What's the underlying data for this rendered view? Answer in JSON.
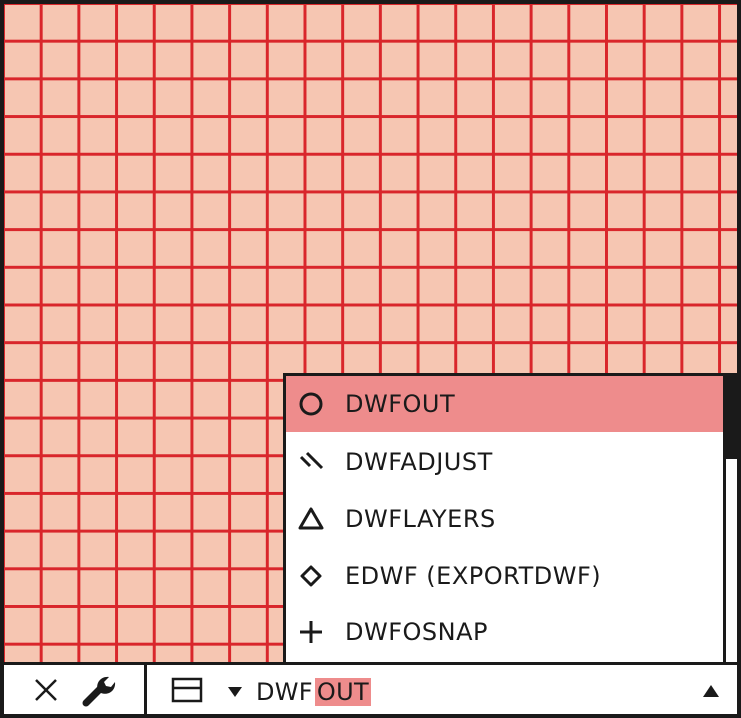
{
  "autocomplete": {
    "items": [
      {
        "label": "DWFOUT",
        "icon": "circle-icon",
        "selected": true
      },
      {
        "label": "DWFADJUST",
        "icon": "diagonal-lines-icon",
        "selected": false
      },
      {
        "label": "DWFLAYERS",
        "icon": "triangle-icon",
        "selected": false
      },
      {
        "label": "EDWF (EXPORTDWF)",
        "icon": "diamond-icon",
        "selected": false
      },
      {
        "label": "DWFOSNAP",
        "icon": "plus-icon",
        "selected": false
      }
    ]
  },
  "command_line": {
    "typed": "DWF",
    "completion": "OUT",
    "close_icon": "close-icon",
    "customize_icon": "wrench-icon",
    "recent_icon": "recent-commands-icon",
    "dropdown_icon": "triangle-down-icon",
    "history_icon": "triangle-up-icon"
  },
  "colors": {
    "grid_line": "#d9262b",
    "background": "#f6c6b2",
    "highlight": "#ee8c8c",
    "border": "#1a1a1a"
  }
}
